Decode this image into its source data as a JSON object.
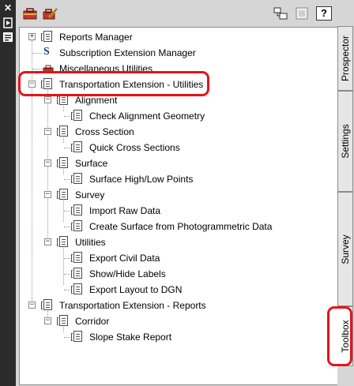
{
  "toolbar": {
    "left_icons": [
      "toolbox-icon",
      "edit-toolbox-icon"
    ],
    "right_icons": [
      "properties-icon",
      "hide-details-icon",
      "help-icon"
    ],
    "help_label": "?"
  },
  "title_strip": {
    "close_glyph": "✕"
  },
  "tree": [
    {
      "label": "Reports Manager",
      "icon": "document-icon",
      "expander": "+"
    },
    {
      "label": "Subscription Extension Manager",
      "icon": "subscription-icon",
      "glyph": "S"
    },
    {
      "label": "Miscellaneous Utilities",
      "icon": "toolbox-icon"
    },
    {
      "label": "Transportation Extension - Utilities",
      "icon": "document-icon",
      "expander": "−"
    },
    {
      "label": "Alignment",
      "icon": "document-icon",
      "expander": "−"
    },
    {
      "label": "Check Alignment Geometry",
      "icon": "document-icon"
    },
    {
      "label": "Cross Section",
      "icon": "document-icon",
      "expander": "−"
    },
    {
      "label": "Quick Cross Sections",
      "icon": "document-icon"
    },
    {
      "label": "Surface",
      "icon": "document-icon",
      "expander": "−"
    },
    {
      "label": "Surface High/Low Points",
      "icon": "document-icon"
    },
    {
      "label": "Survey",
      "icon": "document-icon",
      "expander": "−"
    },
    {
      "label": "Import Raw Data",
      "icon": "document-icon"
    },
    {
      "label": "Create Surface from Photogrammetric Data",
      "icon": "document-icon"
    },
    {
      "label": "Utilities",
      "icon": "document-icon",
      "expander": "−"
    },
    {
      "label": "Export Civil Data",
      "icon": "document-icon"
    },
    {
      "label": "Show/Hide Labels",
      "icon": "document-icon"
    },
    {
      "label": "Export Layout to DGN",
      "icon": "document-icon"
    },
    {
      "label": "Transportation Extension - Reports",
      "icon": "document-icon",
      "expander": "−"
    },
    {
      "label": "Corridor",
      "icon": "document-icon",
      "expander": "−"
    },
    {
      "label": "Slope Stake Report",
      "icon": "document-icon"
    }
  ],
  "tabs": [
    {
      "label": "Prospector",
      "active": false
    },
    {
      "label": "Settings",
      "active": false
    },
    {
      "label": "Survey",
      "active": false
    },
    {
      "label": "Toolbox",
      "active": true
    }
  ],
  "colors": {
    "highlight": "#e3141b",
    "toolbox_red": "#c0392b"
  }
}
